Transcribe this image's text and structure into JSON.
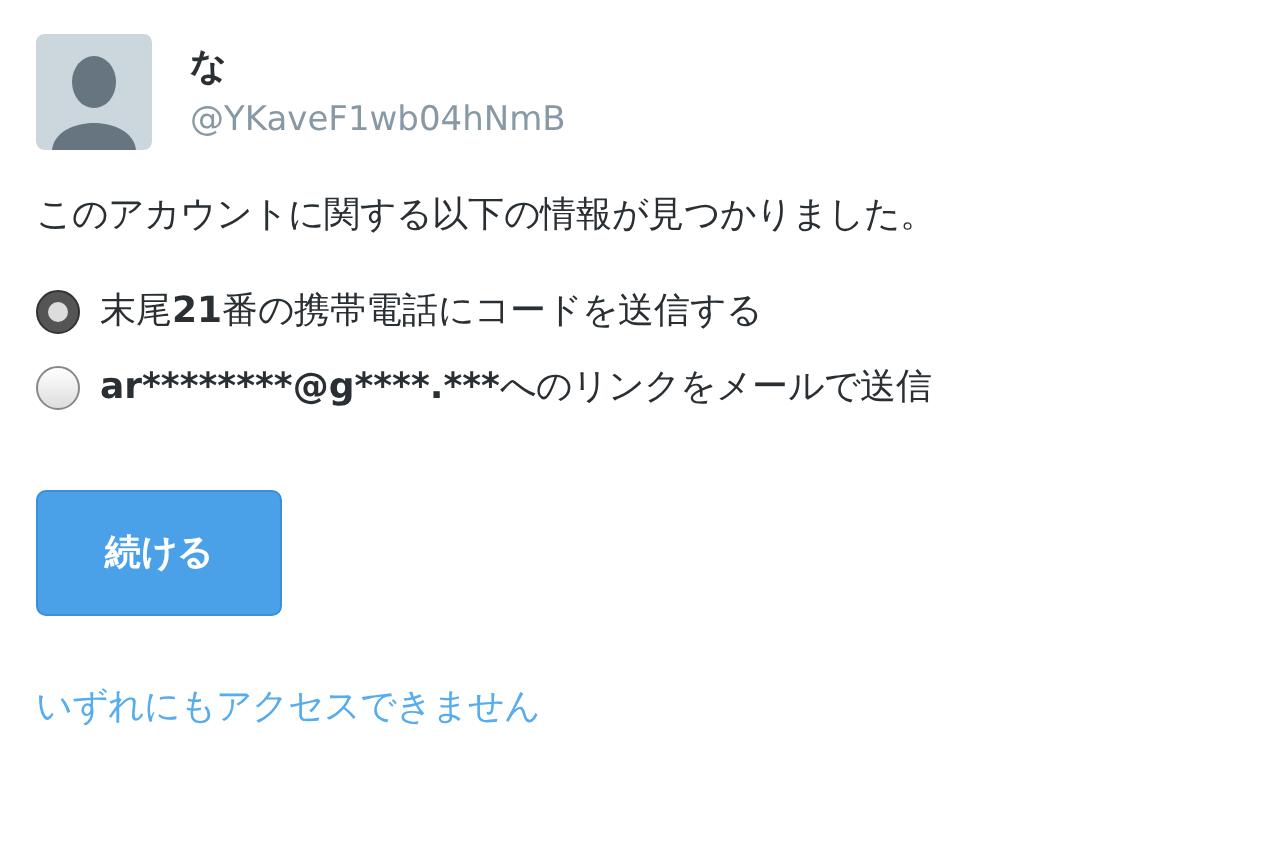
{
  "profile": {
    "name": "な",
    "handle": "@YKaveF1wb04hNmB"
  },
  "message": "このアカウントに関する以下の情報が見つかりました。",
  "options": [
    {
      "parts": [
        {
          "text": "末尾",
          "bold": false
        },
        {
          "text": "21",
          "bold": true
        },
        {
          "text": "番の携帯電話にコードを送信する",
          "bold": false
        }
      ],
      "selected": true
    },
    {
      "parts": [
        {
          "text": "ar********@g****.***",
          "bold": true
        },
        {
          "text": "へのリンクをメールで送信",
          "bold": false
        }
      ],
      "selected": false
    }
  ],
  "button": "続ける",
  "link": "いずれにもアクセスできません"
}
